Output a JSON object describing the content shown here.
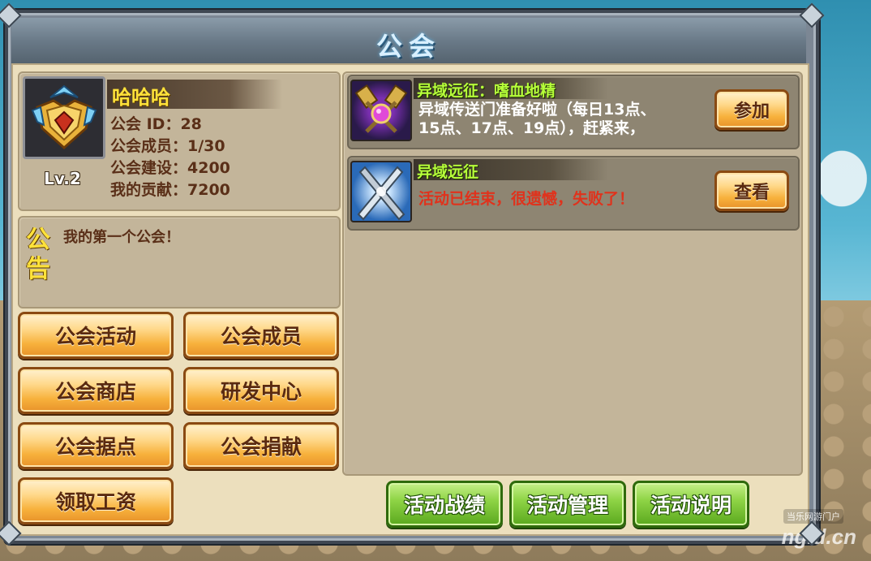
{
  "window": {
    "title": "公会"
  },
  "profile": {
    "guild_name": "哈哈哈",
    "level": "Lv.2",
    "info": [
      "公会  ID：28",
      "公会成员：1/30",
      "公会建设：4200",
      "我的贡献：7200"
    ]
  },
  "notice": {
    "label_line1": "公",
    "label_line2": "告",
    "text": "我的第一个公会！"
  },
  "menu_buttons": {
    "guild_activity": "公会活动",
    "guild_members": "公会成员",
    "guild_shop": "公会商店",
    "research_center": "研发中心",
    "guild_stronghold": "公会据点",
    "guild_donate": "公会捐献",
    "collect_salary": "领取工资"
  },
  "activities": [
    {
      "title": "异域远征：嗜血地精",
      "desc_line1": "异域传送门准备好啦（每日13点、",
      "desc_line2": "15点、17点、19点），赶紧来，",
      "button": "参加",
      "icon": "hammers-gem-icon"
    },
    {
      "title": "异域远征",
      "desc_line1": "活动已结束，很遗憾，失败了！",
      "button": "查看",
      "icon": "crossed-blades-icon"
    }
  ],
  "bottom_buttons": {
    "records": "活动战绩",
    "manage": "活动管理",
    "instructions": "活动说明"
  },
  "watermark": {
    "tag": "当乐网游门户",
    "site": "ng.d.cn"
  },
  "colors": {
    "title_glow": "#5fb6e8",
    "name_yellow": "#ffe23a",
    "activity_title_green": "#b6ff3a",
    "ended_red": "#e0321c",
    "orange_button": "#f7b13c",
    "green_button": "#8fd446"
  }
}
